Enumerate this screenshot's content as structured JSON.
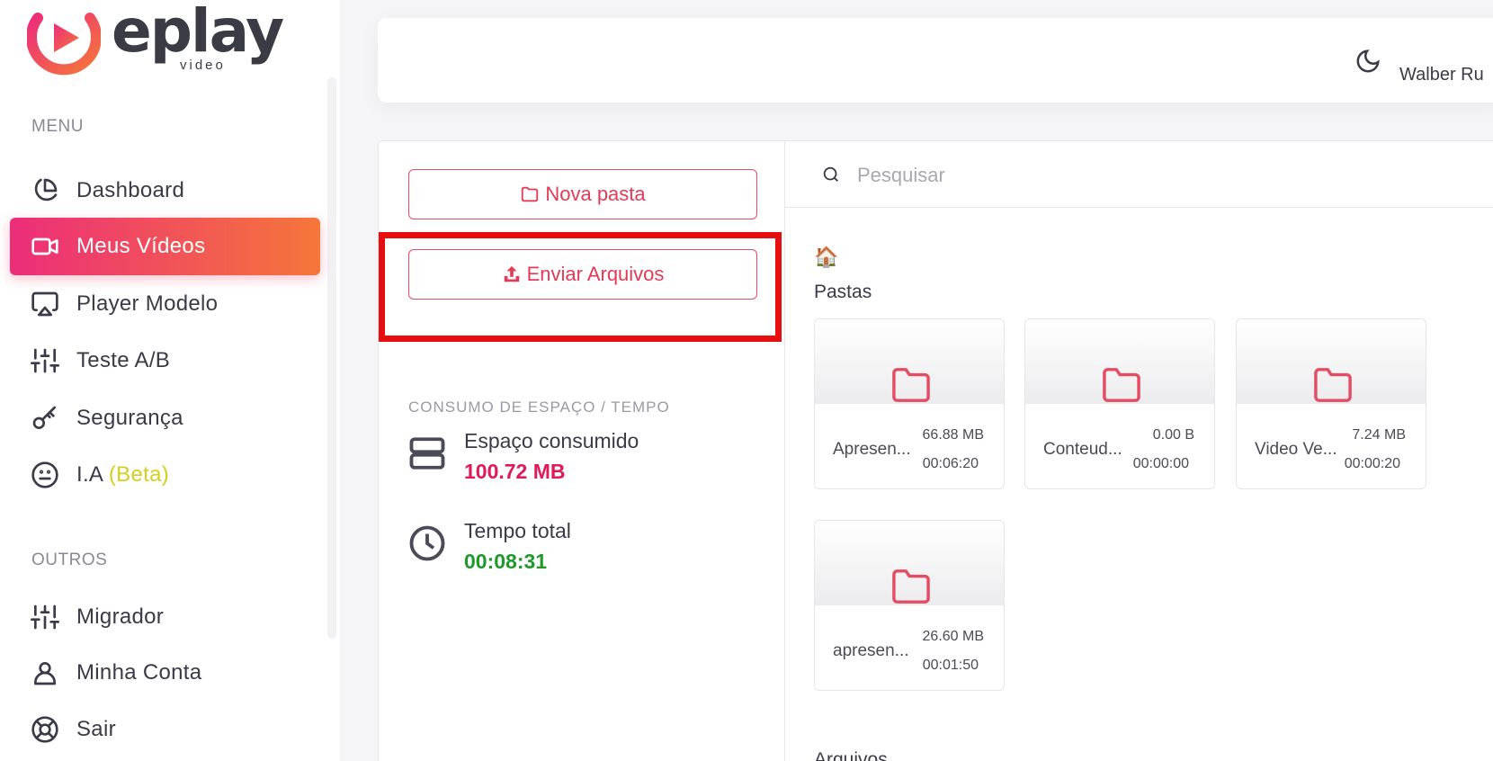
{
  "brand": {
    "name": "eplay",
    "tagline": "video"
  },
  "header": {
    "user_name": "Walber Ru"
  },
  "sidebar": {
    "menu_label": "MENU",
    "others_label": "OUTROS",
    "menu_items": [
      {
        "label": "Dashboard",
        "icon": "pie-chart-icon",
        "active": false
      },
      {
        "label": "Meus Vídeos",
        "icon": "video-camera-icon",
        "active": true
      },
      {
        "label": "Player Modelo",
        "icon": "airplay-icon",
        "active": false
      },
      {
        "label": "Teste A/B",
        "icon": "sliders-icon",
        "active": false
      },
      {
        "label": "Segurança",
        "icon": "key-icon",
        "active": false
      },
      {
        "label": "I.A",
        "suffix": "(Beta)",
        "icon": "smiley-icon",
        "active": false
      }
    ],
    "other_items": [
      {
        "label": "Migrador",
        "icon": "sliders-icon"
      },
      {
        "label": "Minha Conta",
        "icon": "user-icon"
      },
      {
        "label": "Sair",
        "icon": "lifebuoy-icon"
      }
    ]
  },
  "actions": {
    "new_folder": "Nova pasta",
    "upload_files": "Enviar Arquivos"
  },
  "usage": {
    "label": "CONSUMO DE ESPAÇO / TEMPO",
    "space_title": "Espaço consumido",
    "space_value": "100.72 MB",
    "time_title": "Tempo total",
    "time_value": "00:08:31",
    "space_color": "#e0195a",
    "time_color": "#1f9a2a"
  },
  "search": {
    "placeholder": "Pesquisar"
  },
  "content": {
    "home_icon": "🏠",
    "folders_title": "Pastas",
    "files_title": "Arquivos",
    "folders": [
      {
        "name": "Apresen...",
        "size": "66.88 MB",
        "duration": "00:06:20"
      },
      {
        "name": "Conteud...",
        "size": "0.00 B",
        "duration": "00:00:00"
      },
      {
        "name": "Video Ve...",
        "size": "7.24 MB",
        "duration": "00:00:20"
      },
      {
        "name": "apresen...",
        "size": "26.60 MB",
        "duration": "00:01:50"
      }
    ]
  },
  "colors": {
    "accent": "#e33a56",
    "highlight": "#e80e10",
    "beta": "#d4cf1e"
  }
}
